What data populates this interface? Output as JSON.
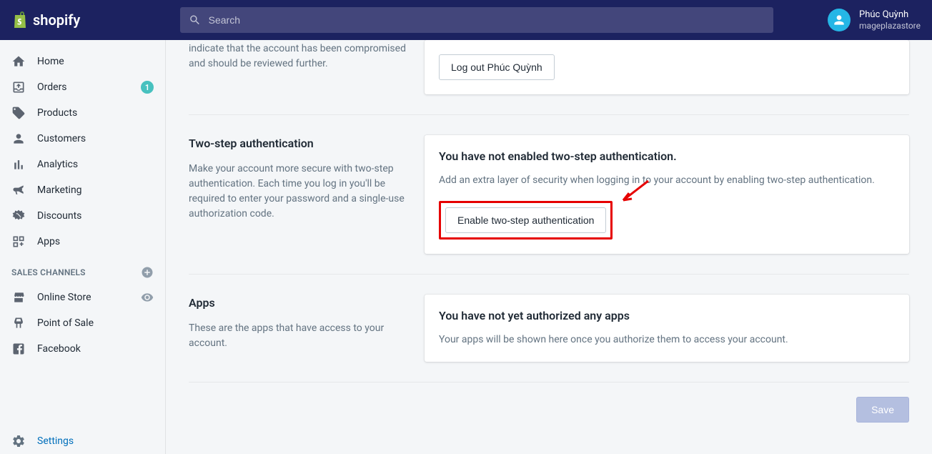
{
  "header": {
    "search_placeholder": "Search",
    "user_name": "Phúc Quỳnh",
    "store_name": "mageplazastore"
  },
  "sidebar": {
    "items": [
      {
        "label": "Home"
      },
      {
        "label": "Orders",
        "badge": "1"
      },
      {
        "label": "Products"
      },
      {
        "label": "Customers"
      },
      {
        "label": "Analytics"
      },
      {
        "label": "Marketing"
      },
      {
        "label": "Discounts"
      },
      {
        "label": "Apps"
      }
    ],
    "channels_header": "SALES CHANNELS",
    "channels": [
      {
        "label": "Online Store"
      },
      {
        "label": "Point of Sale"
      },
      {
        "label": "Facebook"
      }
    ],
    "settings_label": "Settings"
  },
  "sections": {
    "logout": {
      "desc": "indicate that the account has been compromised and should be reviewed further.",
      "button": "Log out Phúc Quỳnh"
    },
    "twostep": {
      "title": "Two-step authentication",
      "desc": "Make your account more secure with two-step authentication. Each time you log in you'll be required to enter your password and a single-use authorization code.",
      "card_title": "You have not enabled two-step authentication.",
      "card_text": "Add an extra layer of security when logging in to your account by enabling two-step authentication.",
      "button": "Enable two-step authentication"
    },
    "apps": {
      "title": "Apps",
      "desc": "These are the apps that have access to your account.",
      "card_title": "You have not yet authorized any apps",
      "card_text": "Your apps will be shown here once you authorize them to access your account."
    }
  },
  "footer": {
    "save_label": "Save"
  }
}
